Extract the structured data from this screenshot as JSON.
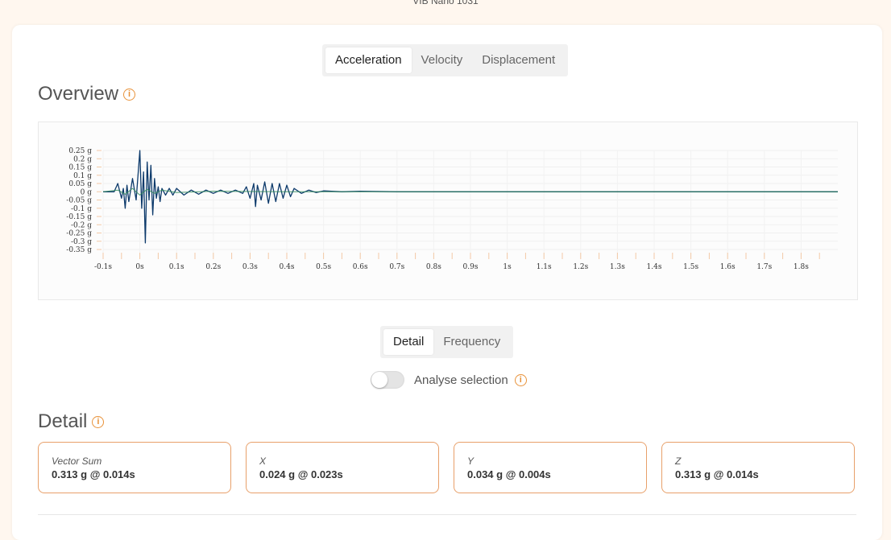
{
  "device_label": "VIB Nano 1031",
  "main_tabs": [
    "Acceleration",
    "Velocity",
    "Displacement"
  ],
  "main_tab_active": 0,
  "overview_title": "Overview",
  "detail_tabs": [
    "Detail",
    "Frequency"
  ],
  "detail_tab_active": 0,
  "analyse_label": "Analyse selection",
  "analyse_enabled": false,
  "detail_title": "Detail",
  "metrics": [
    {
      "label": "Vector Sum",
      "value": "0.313 g @ 0.014s"
    },
    {
      "label": "X",
      "value": "0.024 g @ 0.023s"
    },
    {
      "label": "Y",
      "value": "0.034 g @ 0.004s"
    },
    {
      "label": "Z",
      "value": "0.313 g @ 0.014s"
    }
  ],
  "colors": {
    "accent": "#e8923a",
    "series_main": "#0d3a6b",
    "series_2": "#2f8a5a"
  },
  "chart_data": {
    "type": "line",
    "x_ticks": [
      "-0.1s",
      "0s",
      "0.1s",
      "0.2s",
      "0.3s",
      "0.4s",
      "0.5s",
      "0.6s",
      "0.7s",
      "0.8s",
      "0.9s",
      "1s",
      "1.1s",
      "1.2s",
      "1.3s",
      "1.4s",
      "1.5s",
      "1.6s",
      "1.7s",
      "1.8s"
    ],
    "y_ticks": [
      "0.25 g",
      "0.2 g",
      "0.15 g",
      "0.1 g",
      "0.05 g",
      "0 g",
      "-0.05 g",
      "-0.1 g",
      "-0.15 g",
      "-0.2 g",
      "-0.25 g",
      "-0.3 g",
      "-0.35 g"
    ],
    "xlim": [
      -0.1,
      1.9
    ],
    "ylim": [
      -0.35,
      0.25
    ],
    "grid": true,
    "series": [
      {
        "color": "#0d3a6b",
        "x": [
          -0.1,
          -0.07,
          -0.06,
          -0.05,
          -0.045,
          -0.04,
          -0.035,
          -0.03,
          -0.02,
          -0.01,
          0.0,
          0.005,
          0.01,
          0.015,
          0.02,
          0.025,
          0.03,
          0.035,
          0.04,
          0.045,
          0.05,
          0.055,
          0.06,
          0.07,
          0.08,
          0.09,
          0.1,
          0.12,
          0.14,
          0.16,
          0.18,
          0.2,
          0.22,
          0.24,
          0.26,
          0.28,
          0.29,
          0.3,
          0.31,
          0.315,
          0.32,
          0.33,
          0.34,
          0.35,
          0.36,
          0.37,
          0.38,
          0.39,
          0.4,
          0.41,
          0.42,
          0.44,
          0.46,
          0.48,
          0.5,
          0.55,
          0.6,
          0.7,
          0.8,
          1.0,
          1.2,
          1.4,
          1.6,
          1.8,
          1.9
        ],
        "y": [
          0,
          0.0,
          0.05,
          -0.04,
          0.02,
          -0.1,
          0.04,
          -0.06,
          0.08,
          -0.05,
          0.25,
          -0.1,
          0.12,
          -0.31,
          0.18,
          -0.05,
          0.16,
          -0.14,
          0.08,
          -0.04,
          0.03,
          -0.06,
          0.02,
          -0.02,
          0.02,
          -0.02,
          0.02,
          -0.02,
          0.01,
          -0.015,
          0.01,
          -0.01,
          0.01,
          -0.01,
          0.01,
          -0.01,
          0.03,
          -0.04,
          0.05,
          -0.09,
          0.04,
          -0.05,
          0.06,
          -0.07,
          0.05,
          -0.06,
          0.05,
          -0.04,
          0.04,
          -0.03,
          0.02,
          -0.01,
          0.01,
          -0.005,
          0.005,
          0,
          0.003,
          0,
          0,
          0,
          0,
          0,
          0,
          0,
          0
        ]
      },
      {
        "color": "#2f8a5a",
        "x": [
          -0.1,
          -0.06,
          -0.04,
          -0.02,
          0.0,
          0.02,
          0.04,
          0.06,
          0.1,
          0.2,
          0.4,
          1.9
        ],
        "y": [
          0,
          0.01,
          -0.015,
          0.02,
          -0.02,
          0.015,
          -0.01,
          0.01,
          -0.005,
          0.003,
          0,
          0
        ]
      }
    ]
  }
}
